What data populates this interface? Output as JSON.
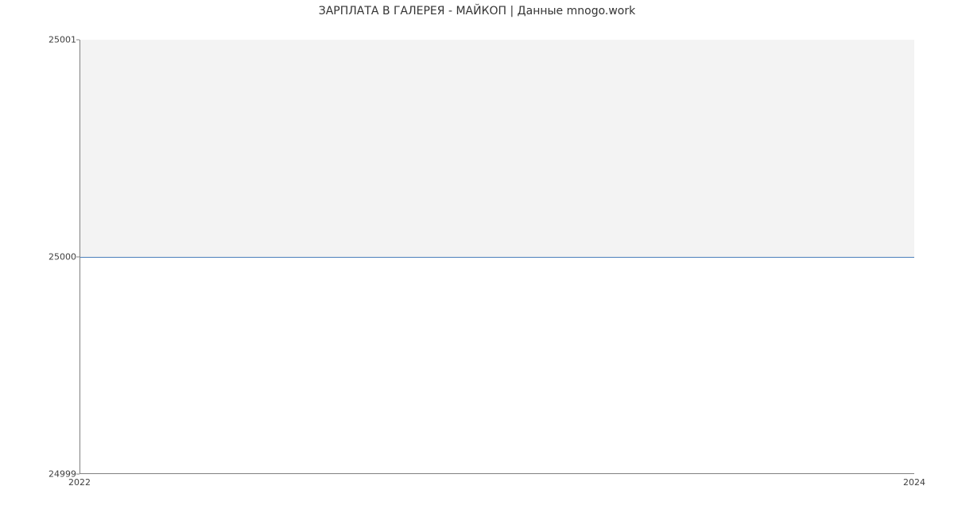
{
  "chart_data": {
    "type": "line",
    "title": "ЗАРПЛАТА В  ГАЛЕРЕЯ - МАЙКОП | Данные mnogo.work",
    "xlabel": "",
    "ylabel": "",
    "x": [
      2022,
      2024
    ],
    "values": [
      25000,
      25000
    ],
    "xlim": [
      2022,
      2024
    ],
    "ylim": [
      24999,
      25001
    ],
    "yticks": [
      24999,
      25000,
      25001
    ],
    "xticks": [
      2022,
      2024
    ],
    "grid": false,
    "legend": false,
    "line_color": "#4a7ebb",
    "fill_above_mid": "#f3f3f3"
  }
}
